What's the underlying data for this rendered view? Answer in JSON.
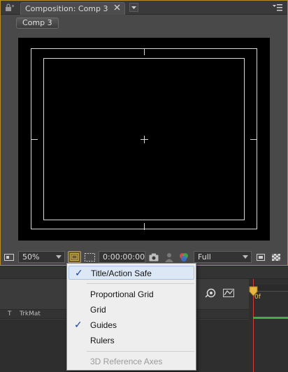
{
  "composition_panel": {
    "tab_title": "Composition: Comp 3",
    "comp_button": "Comp 3"
  },
  "viewer_toolbar": {
    "magnification": "50%",
    "timecode": "0:00:00:00",
    "resolution": "Full"
  },
  "timeline": {
    "col_t": "T",
    "col_trkmat": "TrkMat",
    "time_label": "0f"
  },
  "menu": {
    "items": [
      {
        "label": "Title/Action Safe",
        "checked": true,
        "highlighted": true
      },
      {
        "label": "Proportional Grid",
        "checked": false
      },
      {
        "label": "Grid",
        "checked": false
      },
      {
        "label": "Guides",
        "checked": true
      },
      {
        "label": "Rulers",
        "checked": false
      },
      {
        "label": "3D Reference Axes",
        "checked": false,
        "disabled": true
      }
    ],
    "check_glyph": "✓"
  },
  "colors": {
    "panel_border_accent": "#b58e28",
    "menu_highlight": "#dde8f6",
    "check_color": "#1a3f9c",
    "playhead": "#d23c3c",
    "work_area": "#3bb33b"
  }
}
